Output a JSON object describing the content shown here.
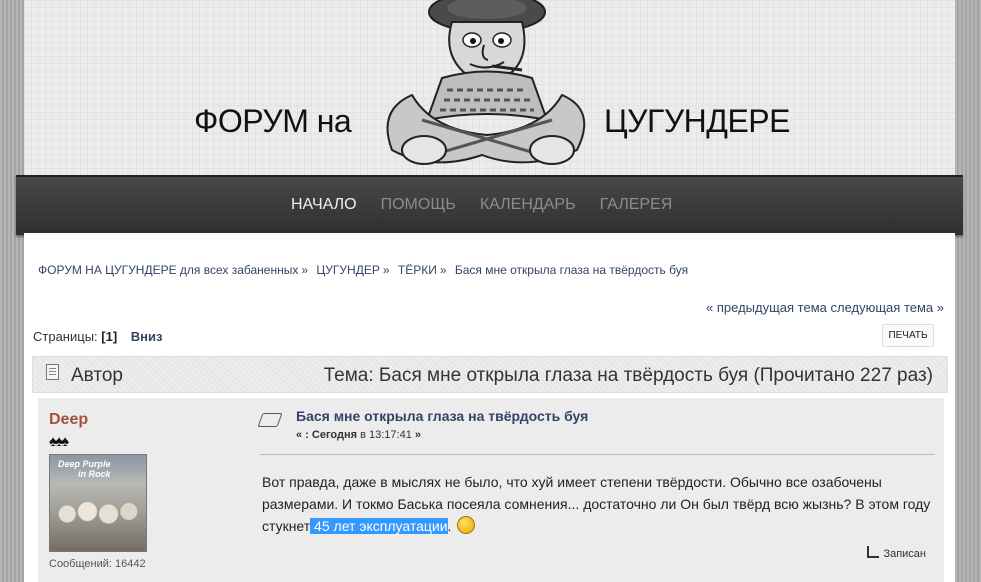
{
  "header": {
    "logo_left": "ФОРУМ на",
    "logo_right": "ЦУГУНДЕРЕ"
  },
  "nav": {
    "items": [
      "НАЧАЛО",
      "ПОМОЩЬ",
      "КАЛЕНДАРЬ",
      "ГАЛЕРЕЯ"
    ],
    "active": "НАЧАЛО"
  },
  "breadcrumb": {
    "items": [
      "ФОРУМ НА ЦУГУНДЕРЕ для всех забаненных",
      "ЦУГУНДЕР",
      "ТЁРКИ",
      "Бася мне открыла глаза на твёрдость буя"
    ],
    "separator": "»"
  },
  "topic_nav": "« предыдущая тема следующая тема »",
  "pages": {
    "label": "Страницы:",
    "current": "[1]",
    "down": "Вниз"
  },
  "print_label": "ПЕЧАТЬ",
  "category_bar": {
    "author_label": "Автор",
    "topic_title": "Тема: Бася мне открыла глаза на твёрдость буя  (Прочитано 227 раз)"
  },
  "post": {
    "poster_name": "Deep",
    "rank": "♠♠♠",
    "avatar_text_1": "Deep Purple",
    "avatar_text_2": "in Rock",
    "post_count": "Сообщений: 16442",
    "title": "Бася мне открыла глаза на твёрдость буя",
    "date_prefix": "« :",
    "date_day": "Сегодня",
    "date_in": "в",
    "date_time": "13:17:41",
    "date_suffix": "»",
    "body_before": "Вот правда, даже в мыслях не было, что хуй имеет степени твёрдости. Обычно все озабочены размерами. И токмо Баська посеяла сомнения... достаточно ли Он был твёрд всю жызнь? В этом году стукнет",
    "body_highlight": " 45 лет эксплуатации",
    "body_after": ".",
    "saved_label": "Записан"
  },
  "colors": {
    "link": "#334466",
    "poster_name": "#a0523f",
    "nav_bg": "#3a3a3a",
    "highlight": "#3399ff"
  }
}
